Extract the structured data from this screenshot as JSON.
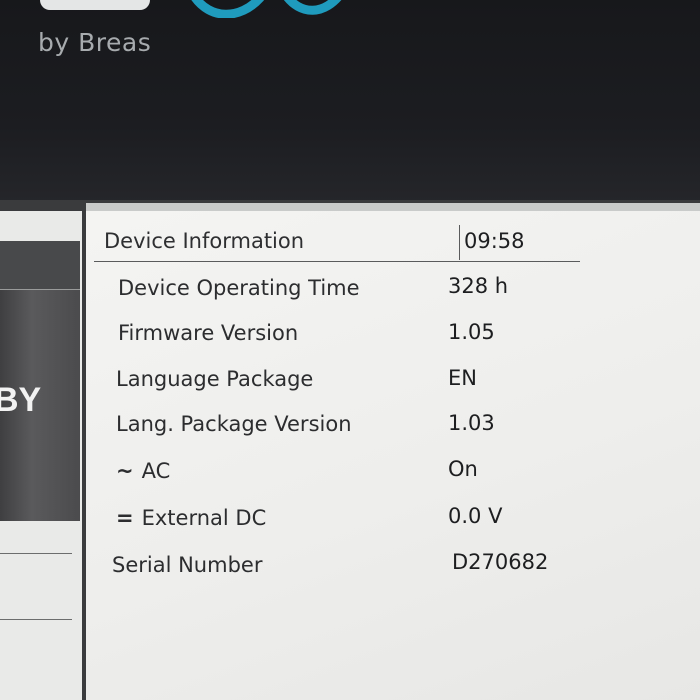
{
  "brand": {
    "tagline": "by Breas"
  },
  "side_panel": {
    "label": "BY"
  },
  "device_info": {
    "title": "Device Information",
    "time": "09:58",
    "rows": [
      {
        "label": "Device Operating Time",
        "value": "328 h"
      },
      {
        "label": "Firmware Version",
        "value": "1.05"
      },
      {
        "label": "Language Package",
        "value": "EN"
      },
      {
        "label": "Lang. Package Version",
        "value": "1.03"
      },
      {
        "label": "AC",
        "symbol": "~",
        "value": "On"
      },
      {
        "label": "External DC",
        "symbol": "=",
        "value": "0.0 V"
      },
      {
        "label": "Serial Number",
        "value": "D270682"
      }
    ]
  },
  "colors": {
    "accent_logo": "#1f9bbd",
    "bezel": "#17181b",
    "panel_background": "#f1f1ef",
    "text": "#2c2d2f"
  }
}
